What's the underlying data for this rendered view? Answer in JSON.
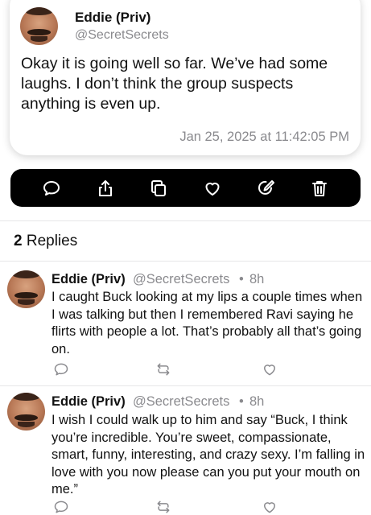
{
  "main_post": {
    "name": "Eddie (Priv)",
    "handle": "@SecretSecrets",
    "text": "Okay it is going well so far. We’ve had some laughs. I don’t think the group suspects anything is even up.",
    "timestamp": "Jan 25, 2025 at 11:42:05 PM"
  },
  "action_bar": {
    "icons": [
      "comment-icon",
      "share-icon",
      "copy-icon",
      "heart-icon",
      "edit-icon",
      "trash-icon"
    ]
  },
  "replies_header": {
    "count": "2",
    "label": "Replies"
  },
  "replies": [
    {
      "name": "Eddie (Priv)",
      "handle": "@SecretSecrets",
      "dot": "•",
      "age": "8h",
      "text": "I caught Buck looking at my lips a couple times when I was talking but then I remembered Ravi saying he flirts with people a lot. That’s probably all that’s going on."
    },
    {
      "name": "Eddie (Priv)",
      "handle": "@SecretSecrets",
      "dot": "•",
      "age": "8h",
      "text": "I wish I could walk up to him and say “Buck, I think you’re incredible. You’re sweet, compassionate, smart, funny, interesting, and crazy sexy. I’m falling in love with you now please can you put your mouth on me.”"
    }
  ]
}
